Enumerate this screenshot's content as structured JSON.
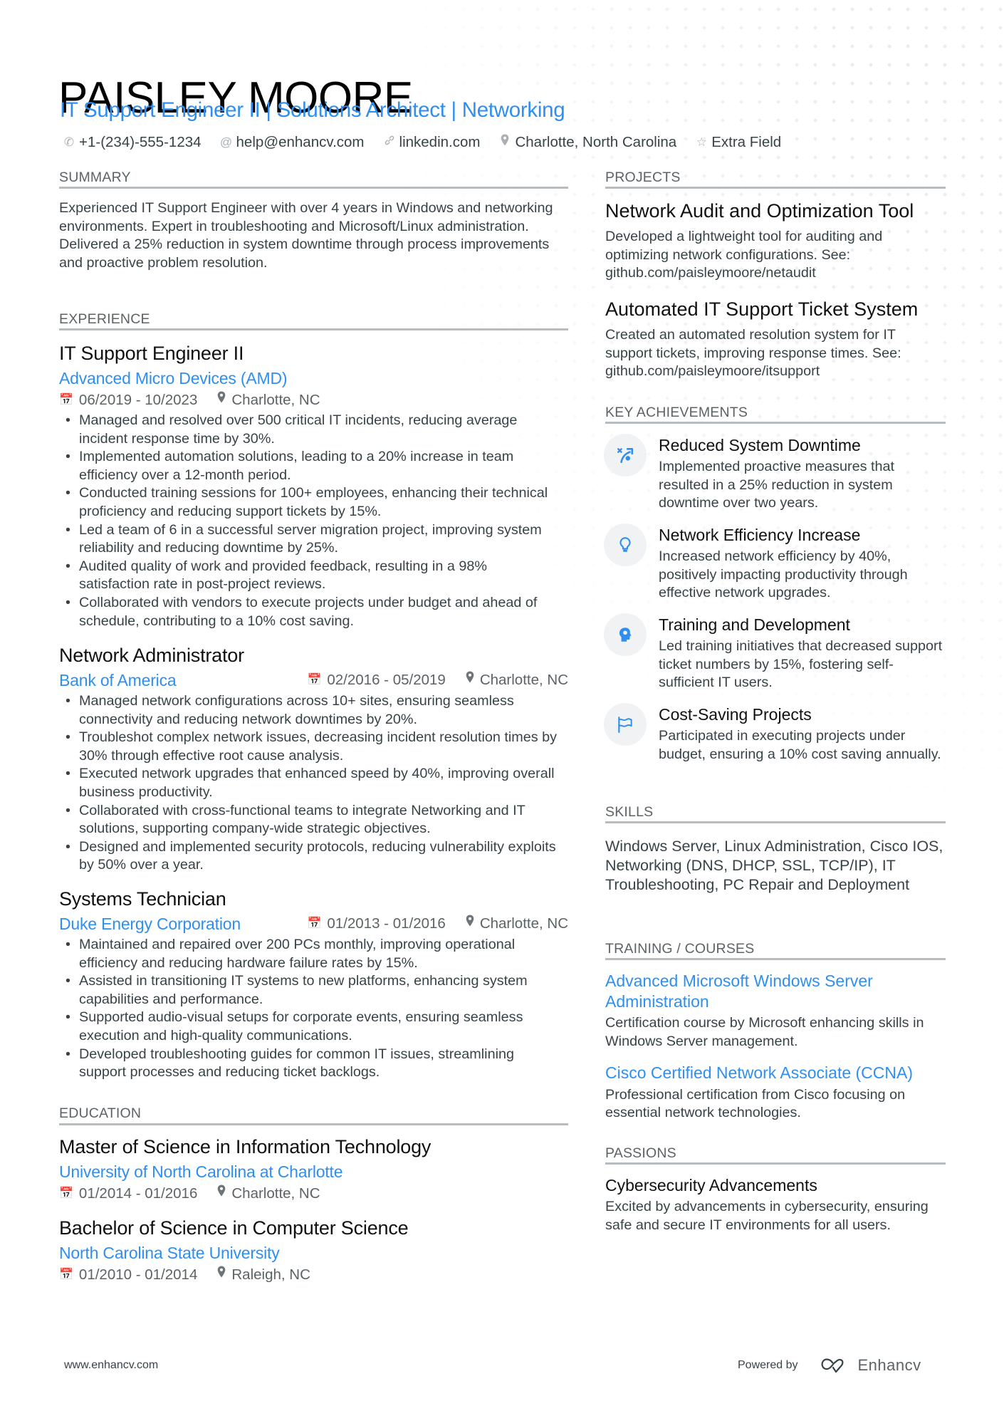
{
  "header": {
    "name": "PAISLEY MOORE",
    "subtitle": "IT Support Engineer II | Solutions Architect | Networking",
    "contacts": [
      {
        "icon": "phone-icon",
        "text": "+1-(234)-555-1234"
      },
      {
        "icon": "at-icon",
        "text": "help@enhancv.com"
      },
      {
        "icon": "link-icon",
        "text": "linkedin.com"
      },
      {
        "icon": "location-pin-icon",
        "text": "Charlotte, North Carolina"
      },
      {
        "icon": "star-icon",
        "text": "Extra Field"
      }
    ]
  },
  "summary": {
    "label": "SUMMARY",
    "text": "Experienced IT Support Engineer with over 4 years in Windows and networking environments. Expert in troubleshooting and Microsoft/Linux administration. Delivered a 25% reduction in system downtime through process improvements and proactive problem resolution."
  },
  "experience": {
    "label": "EXPERIENCE",
    "jobs": [
      {
        "title": "IT Support Engineer II",
        "company": "Advanced Micro Devices (AMD)",
        "dates": "06/2019 - 10/2023",
        "location": "Charlotte, NC",
        "bullets": [
          "Managed and resolved over 500 critical IT incidents, reducing average incident response time by 30%.",
          "Implemented automation solutions, leading to a 20% increase in team efficiency over a 12-month period.",
          "Conducted training sessions for 100+ employees, enhancing their technical proficiency and reducing support tickets by 15%.",
          "Led a team of 6 in a successful server migration project, improving system reliability and reducing downtime by 25%.",
          "Audited quality of work and provided feedback, resulting in a 98% satisfaction rate in post-project reviews.",
          "Collaborated with vendors to execute projects under budget and ahead of schedule, contributing to a 10% cost saving."
        ]
      },
      {
        "title": "Network Administrator",
        "company": "Bank of America",
        "dates": "02/2016 - 05/2019",
        "location": "Charlotte, NC",
        "bullets": [
          "Managed network configurations across 10+ sites, ensuring seamless connectivity and reducing network downtimes by 20%.",
          "Troubleshot complex network issues, decreasing incident resolution times by 30% through effective root cause analysis.",
          "Executed network upgrades that enhanced speed by 40%, improving overall business productivity.",
          "Collaborated with cross-functional teams to integrate Networking and IT solutions, supporting company-wide strategic objectives.",
          "Designed and implemented security protocols, reducing vulnerability exploits by 50% over a year."
        ]
      },
      {
        "title": "Systems Technician",
        "company": "Duke Energy Corporation",
        "dates": "01/2013 - 01/2016",
        "location": "Charlotte, NC",
        "bullets": [
          "Maintained and repaired over 200 PCs monthly, improving operational efficiency and reducing hardware failure rates by 15%.",
          "Assisted in transitioning IT systems to new platforms, enhancing system capabilities and performance.",
          "Supported audio-visual setups for corporate events, ensuring seamless execution and high-quality communications.",
          "Developed troubleshooting guides for common IT issues, streamlining support processes and reducing ticket backlogs."
        ]
      }
    ]
  },
  "education": {
    "label": "EDUCATION",
    "items": [
      {
        "degree": "Master of Science in Information Technology",
        "school": "University of North Carolina at Charlotte",
        "dates": "01/2014 - 01/2016",
        "location": "Charlotte, NC"
      },
      {
        "degree": "Bachelor of Science in Computer Science",
        "school": "North Carolina State University",
        "dates": "01/2010 - 01/2014",
        "location": "Raleigh, NC"
      }
    ]
  },
  "projects": {
    "label": "PROJECTS",
    "items": [
      {
        "title": "Network Audit and Optimization Tool",
        "description": "Developed a lightweight tool for auditing and optimizing network configurations. See: github.com/paisleymoore/netaudit"
      },
      {
        "title": "Automated IT Support Ticket System",
        "description": "Created an automated resolution system for IT support tickets, improving response times. See: github.com/paisleymoore/itsupport"
      }
    ]
  },
  "achievements": {
    "label": "KEY ACHIEVEMENTS",
    "items": [
      {
        "icon": "strategy-arrow-icon",
        "title": "Reduced System Downtime",
        "description": "Implemented proactive measures that resulted in a 25% reduction in system downtime over two years."
      },
      {
        "icon": "lightbulb-icon",
        "title": "Network Efficiency Increase",
        "description": "Increased network efficiency by 40%, positively impacting productivity through effective network upgrades."
      },
      {
        "icon": "head-brain-icon",
        "title": "Training and Development",
        "description": "Led training initiatives that decreased support ticket numbers by 15%, fostering self-sufficient IT users."
      },
      {
        "icon": "flag-icon",
        "title": "Cost-Saving Projects",
        "description": "Participated in executing projects under budget, ensuring a 10% cost saving annually."
      }
    ]
  },
  "skills": {
    "label": "SKILLS",
    "text": "Windows Server, Linux Administration, Cisco IOS, Networking (DNS, DHCP, SSL, TCP/IP), IT Troubleshooting, PC Repair and Deployment"
  },
  "training": {
    "label": "TRAINING / COURSES",
    "items": [
      {
        "title": "Advanced Microsoft Windows Server Administration",
        "description": "Certification course by Microsoft enhancing skills in Windows Server management."
      },
      {
        "title": "Cisco Certified Network Associate (CCNA)",
        "description": "Professional certification from Cisco focusing on essential network technologies."
      }
    ]
  },
  "passions": {
    "label": "PASSIONS",
    "items": [
      {
        "title": "Cybersecurity Advancements",
        "description": "Excited by advancements in cybersecurity, ensuring safe and secure IT environments for all users."
      }
    ]
  },
  "footer": {
    "website": "www.enhancv.com",
    "powered_by": "Powered by",
    "brand": "Enhancv"
  },
  "colors": {
    "accent": "#2e8ff0",
    "text": "#384347",
    "heading": "#111111",
    "rule": "#b9bcbf",
    "icon_circle": "#f1f2f3"
  }
}
